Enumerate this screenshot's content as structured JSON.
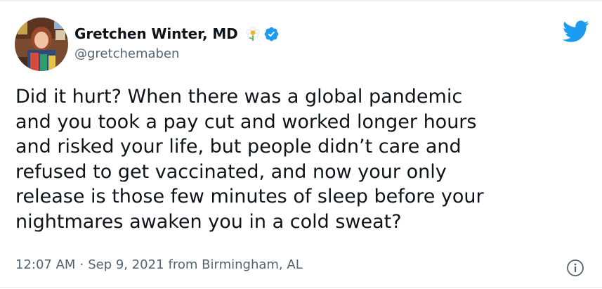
{
  "tweet": {
    "author": {
      "display_name": "Gretchen Winter, MD",
      "handle": "@gretchemaben",
      "name_emoji": "flower-icon",
      "verified_icon": "verified-badge-icon"
    },
    "brand_icon": "twitter-bird-icon",
    "text_lines": [
      "Did it hurt? When there was a global pandemic",
      "and you took a pay cut and worked longer hours",
      "and risked your life, but people didn’t care and",
      "refused to get vaccinated, and now your only",
      "release is those few minutes of sleep before your",
      "nightmares awaken you in a cold sweat?"
    ],
    "meta": {
      "time": "12:07 AM",
      "separator": "·",
      "date": "Sep 9, 2021",
      "source": "from Birmingham, AL"
    },
    "info_icon": "info-icon"
  },
  "colors": {
    "text_primary": "#0f1419",
    "text_secondary": "#536471",
    "twitter_blue": "#1d9bf0",
    "border": "#e6ecf0"
  }
}
